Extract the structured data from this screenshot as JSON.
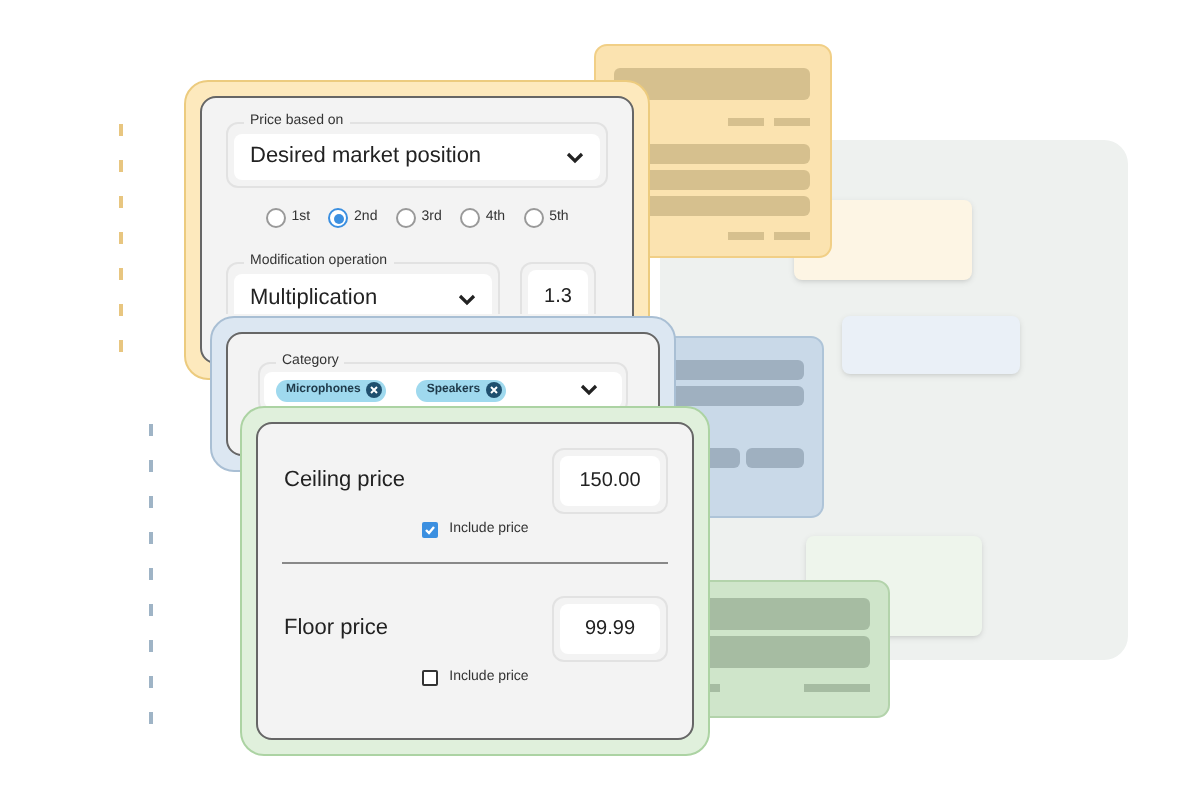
{
  "pricing_card": {
    "price_based_on": {
      "label": "Price based on",
      "value": "Desired market position"
    },
    "positions": [
      {
        "label": "1st",
        "selected": false
      },
      {
        "label": "2nd",
        "selected": true
      },
      {
        "label": "3rd",
        "selected": false
      },
      {
        "label": "4th",
        "selected": false
      },
      {
        "label": "5th",
        "selected": false
      }
    ],
    "modification_operation": {
      "label": "Modification operation",
      "value": "Multiplication"
    },
    "factor": "1.3"
  },
  "category_card": {
    "label": "Category",
    "tags": [
      "Microphones",
      "Speakers"
    ]
  },
  "limits_card": {
    "limits": [
      {
        "label": "Ceiling price",
        "value": "150.00",
        "checkbox_label": "Include price",
        "checked": true
      },
      {
        "label": "Floor price",
        "value": "99.99",
        "checkbox_label": "Include price",
        "checked": false
      }
    ]
  }
}
